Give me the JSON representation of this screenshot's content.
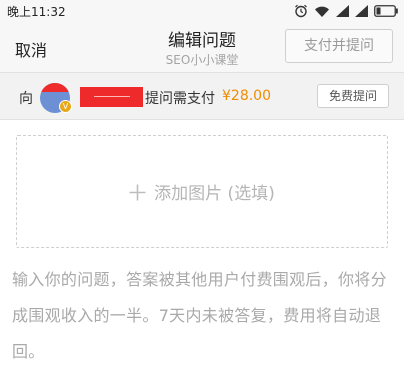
{
  "status_bar": {
    "time": "晚上11:32",
    "icons": [
      "alarm-icon",
      "wifi-icon",
      "signal-icon",
      "signal-icon",
      "battery-icon"
    ]
  },
  "nav": {
    "cancel_label": "取消",
    "title": "编辑问题",
    "subtitle": "SEO小小课堂",
    "submit_label": "支付并提问"
  },
  "recipient": {
    "prefix": "向",
    "pay_label": "提问需支付",
    "amount": "¥28.00",
    "free_ask_label": "免费提问",
    "badge_letter": "V"
  },
  "add_image": {
    "label": "添加图片 (选填)"
  },
  "question": {
    "placeholder": "输入你的问题，答案被其他用户付费围观后，你将分成围观收入的一半。7天内未被答复，费用将自动退回。"
  },
  "colors": {
    "accent_amount": "#f08c00",
    "redaction": "#ee2a2a",
    "badge": "#e8a81a"
  }
}
